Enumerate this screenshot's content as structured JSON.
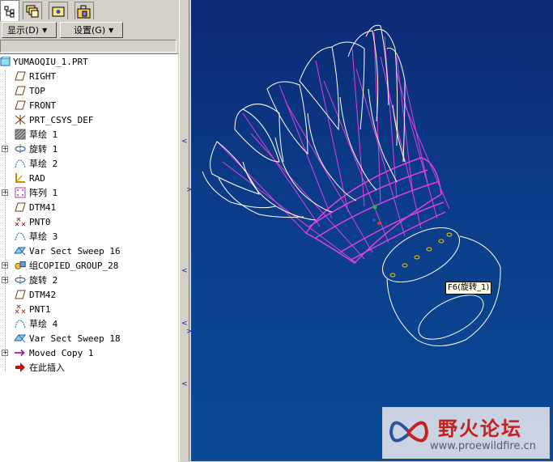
{
  "tabs": [
    {
      "icon": "model-tree-icon",
      "active": true
    },
    {
      "icon": "layers-icon",
      "active": false
    },
    {
      "icon": "favorites-icon",
      "active": false
    },
    {
      "icon": "folder-browser-icon",
      "active": false
    }
  ],
  "menu": {
    "show_label": "显示(D)",
    "settings_label": "设置(G)"
  },
  "tree": {
    "root": "YUMAOQIU_1.PRT",
    "items": [
      {
        "label": "RIGHT",
        "icon": "datum-plane-icon",
        "expandable": false
      },
      {
        "label": "TOP",
        "icon": "datum-plane-icon",
        "expandable": false
      },
      {
        "label": "FRONT",
        "icon": "datum-plane-icon",
        "expandable": false
      },
      {
        "label": "PRT_CSYS_DEF",
        "icon": "csys-icon",
        "expandable": false
      },
      {
        "label": "草绘 1",
        "icon": "sketch-hatch-icon",
        "expandable": false
      },
      {
        "label": "旋转 1",
        "icon": "revolve-icon",
        "expandable": true
      },
      {
        "label": "草绘 2",
        "icon": "sketch-curve-icon",
        "expandable": false
      },
      {
        "label": "RAD",
        "icon": "datum-axis-icon",
        "expandable": false
      },
      {
        "label": "阵列 1",
        "icon": "pattern-icon",
        "expandable": true
      },
      {
        "label": "DTM41",
        "icon": "datum-plane-icon",
        "expandable": false
      },
      {
        "label": "PNT0",
        "icon": "datum-point-icon",
        "expandable": false
      },
      {
        "label": "草绘 3",
        "icon": "sketch-curve-icon",
        "expandable": false
      },
      {
        "label": "Var Sect Sweep 16",
        "icon": "var-sweep-icon",
        "expandable": false
      },
      {
        "label": "组COPIED_GROUP_28",
        "icon": "group-icon",
        "expandable": true
      },
      {
        "label": "旋转 2",
        "icon": "revolve-icon",
        "expandable": true
      },
      {
        "label": "DTM42",
        "icon": "datum-plane-icon",
        "expandable": false
      },
      {
        "label": "PNT1",
        "icon": "datum-point-icon",
        "expandable": false
      },
      {
        "label": "草绘 4",
        "icon": "sketch-curve-icon",
        "expandable": false
      },
      {
        "label": "Var Sect Sweep 18",
        "icon": "var-sweep-icon",
        "expandable": false
      },
      {
        "label": "Moved Copy 1",
        "icon": "moved-copy-icon",
        "expandable": true
      },
      {
        "label": "在此插入",
        "icon": "insert-here-arrow-icon",
        "expandable": false
      }
    ]
  },
  "viewport": {
    "callout_label": "F6(旋转_1)"
  },
  "watermark": {
    "title": "野火论坛",
    "url": "www.proewildfire.cn"
  },
  "colors": {
    "viewport_top": "#0d2a74",
    "viewport_bottom": "#0a4b96",
    "geometry_white": "#ffffff",
    "geometry_magenta": "#e040e0",
    "watermark_red": "#c81e1e"
  }
}
